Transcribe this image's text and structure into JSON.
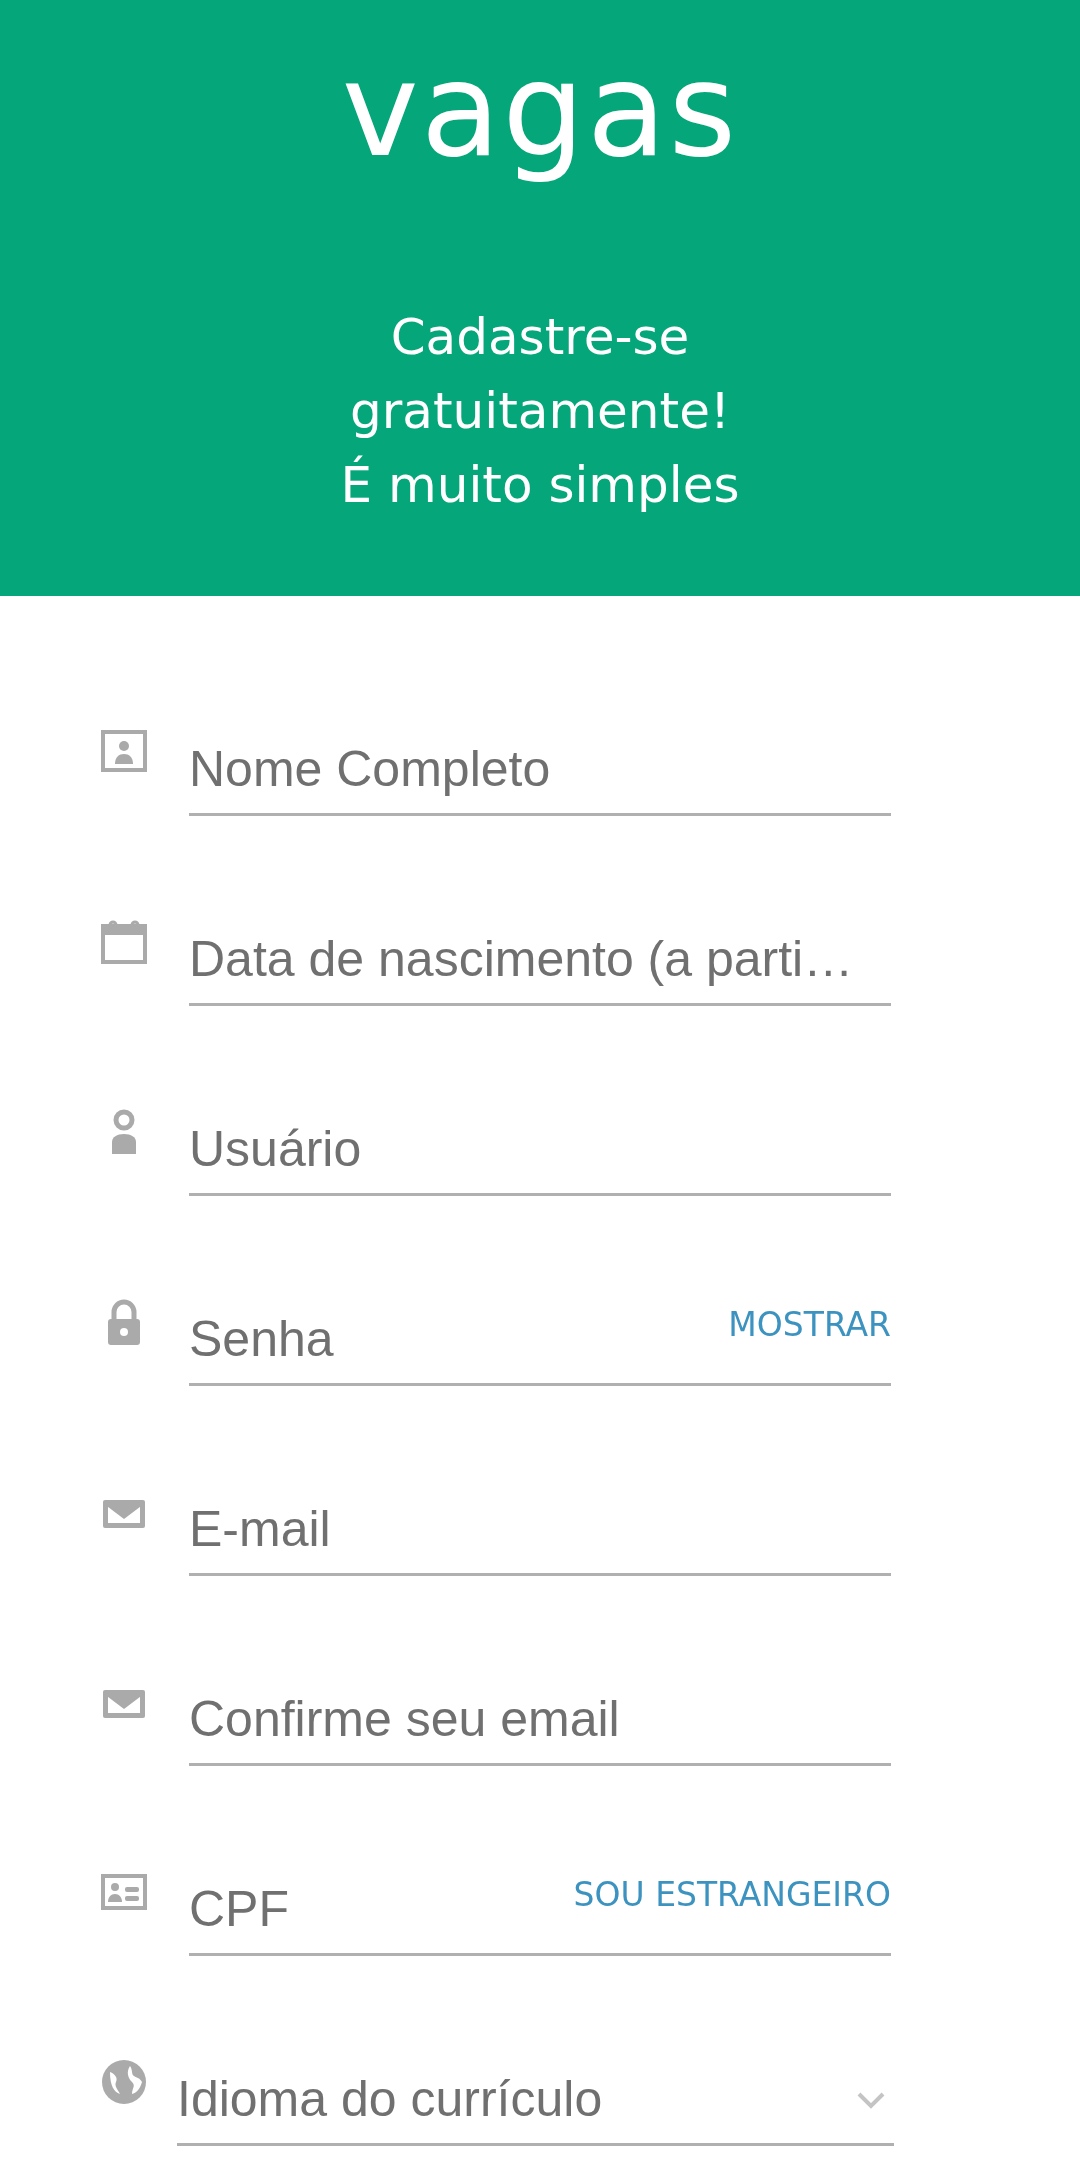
{
  "header": {
    "logo": "vagas",
    "tagline": "Cadastre-se\ngratuitamente!\nÉ muito simples"
  },
  "fields": [
    {
      "kind": "text",
      "placeholder": "Nome Completo"
    },
    {
      "kind": "text",
      "placeholder": "Data de nascimento (a parti…"
    },
    {
      "kind": "text",
      "placeholder": "Usuário"
    },
    {
      "kind": "text",
      "placeholder": "Senha",
      "action": "MOSTRAR"
    },
    {
      "kind": "text",
      "placeholder": "E-mail"
    },
    {
      "kind": "text",
      "placeholder": "Confirme seu email"
    },
    {
      "kind": "text",
      "placeholder": "CPF",
      "action": "SOU ESTRANGEIRO"
    },
    {
      "kind": "select",
      "placeholder": "Idioma do currículo"
    }
  ]
}
